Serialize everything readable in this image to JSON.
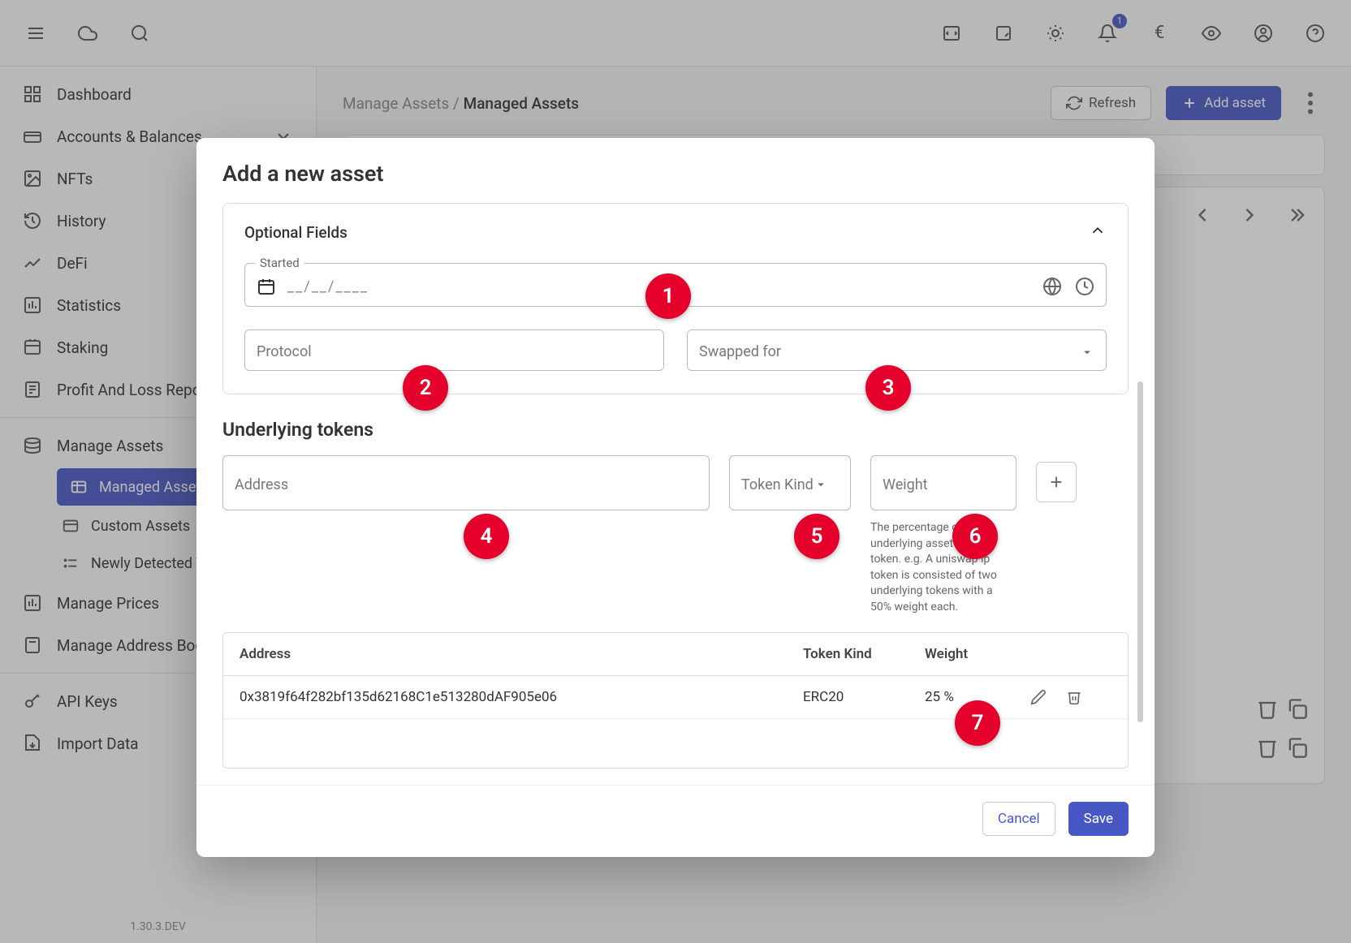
{
  "topbar": {
    "currency": "€",
    "notification_count": "1"
  },
  "sidebar": {
    "items": [
      {
        "label": "Dashboard"
      },
      {
        "label": "Accounts & Balances"
      },
      {
        "label": "NFTs"
      },
      {
        "label": "History"
      },
      {
        "label": "DeFi"
      },
      {
        "label": "Statistics"
      },
      {
        "label": "Staking"
      },
      {
        "label": "Profit And Loss Report"
      },
      {
        "label": "Manage Assets"
      },
      {
        "label": "Manage Prices"
      },
      {
        "label": "Manage Address Book"
      },
      {
        "label": "API Keys"
      },
      {
        "label": "Import Data"
      }
    ],
    "sub_assets": [
      {
        "label": "Managed Assets"
      },
      {
        "label": "Custom Assets"
      },
      {
        "label": "Newly Detected Tokens"
      }
    ],
    "version": "1.30.3.DEV"
  },
  "page": {
    "breadcrumb_root": "Manage Assets",
    "breadcrumb_sep": " / ",
    "breadcrumb_current": "Managed Assets",
    "refresh_btn": "Refresh",
    "add_btn": "Add asset"
  },
  "modal": {
    "title": "Add a new asset",
    "optional_title": "Optional Fields",
    "started_label": "Started",
    "started_placeholder": "__/__/____",
    "protocol_label": "Protocol",
    "swapped_label": "Swapped for",
    "underlying_title": "Underlying tokens",
    "u_address_label": "Address",
    "u_kind_label": "Token Kind",
    "u_weight_label": "Weight",
    "weight_hint": "The percentage of an underlying asset in the token. e.g. A uniswap lp token is consisted of two underlying tokens with a 50% weight each.",
    "table": {
      "h_address": "Address",
      "h_kind": "Token Kind",
      "h_weight": "Weight",
      "rows": [
        {
          "address": "0x3819f64f282bf135d62168C1e513280dAF905e06",
          "kind": "ERC20",
          "weight": "25 %"
        }
      ]
    },
    "cancel": "Cancel",
    "save": "Save"
  },
  "dots": [
    "1",
    "2",
    "3",
    "4",
    "5",
    "6",
    "7"
  ]
}
